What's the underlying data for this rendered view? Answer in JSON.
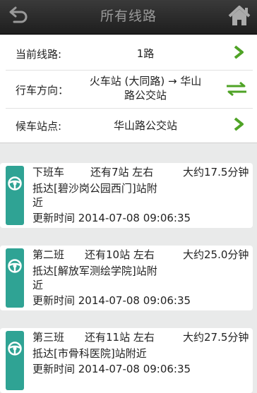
{
  "header": {
    "title": "所有线路",
    "back_icon": "back-arrow-icon",
    "home_icon": "home-icon"
  },
  "info": {
    "route_label": "当前线路:",
    "route_value": "1路",
    "direction_label": "行车方向：",
    "direction_line1": "火车站 (大同路) → 华山",
    "direction_line2": "路公交站",
    "stop_label": "候车站点:",
    "stop_value": "华山路公交站"
  },
  "buses": [
    {
      "name": "下班车",
      "remaining": "还有7站 左右",
      "eta": "大约17.5分钟",
      "arrive_line1": "抵达[碧沙岗公园西门]站附",
      "arrive_line2": "近",
      "updated": "更新时间 2014-07-08 09:06:35"
    },
    {
      "name": "第二班",
      "remaining": "还有10站 左右",
      "eta": "大约25.0分钟",
      "arrive_line1": "抵达[解放军测绘学院]站附",
      "arrive_line2": "近",
      "updated": "更新时间 2014-07-08 09:06:35"
    },
    {
      "name": "第三班",
      "remaining": "还有11站 左右",
      "eta": "大约27.5分钟",
      "arrive_line1": "抵达[市骨科医院]站附近",
      "arrive_line2": "",
      "updated": "更新时间 2014-07-08 09:06:35"
    }
  ],
  "colors": {
    "accent_green": "#4fa326",
    "bus_strip": "#2fa394",
    "header_bg": "#2b2b2b"
  }
}
